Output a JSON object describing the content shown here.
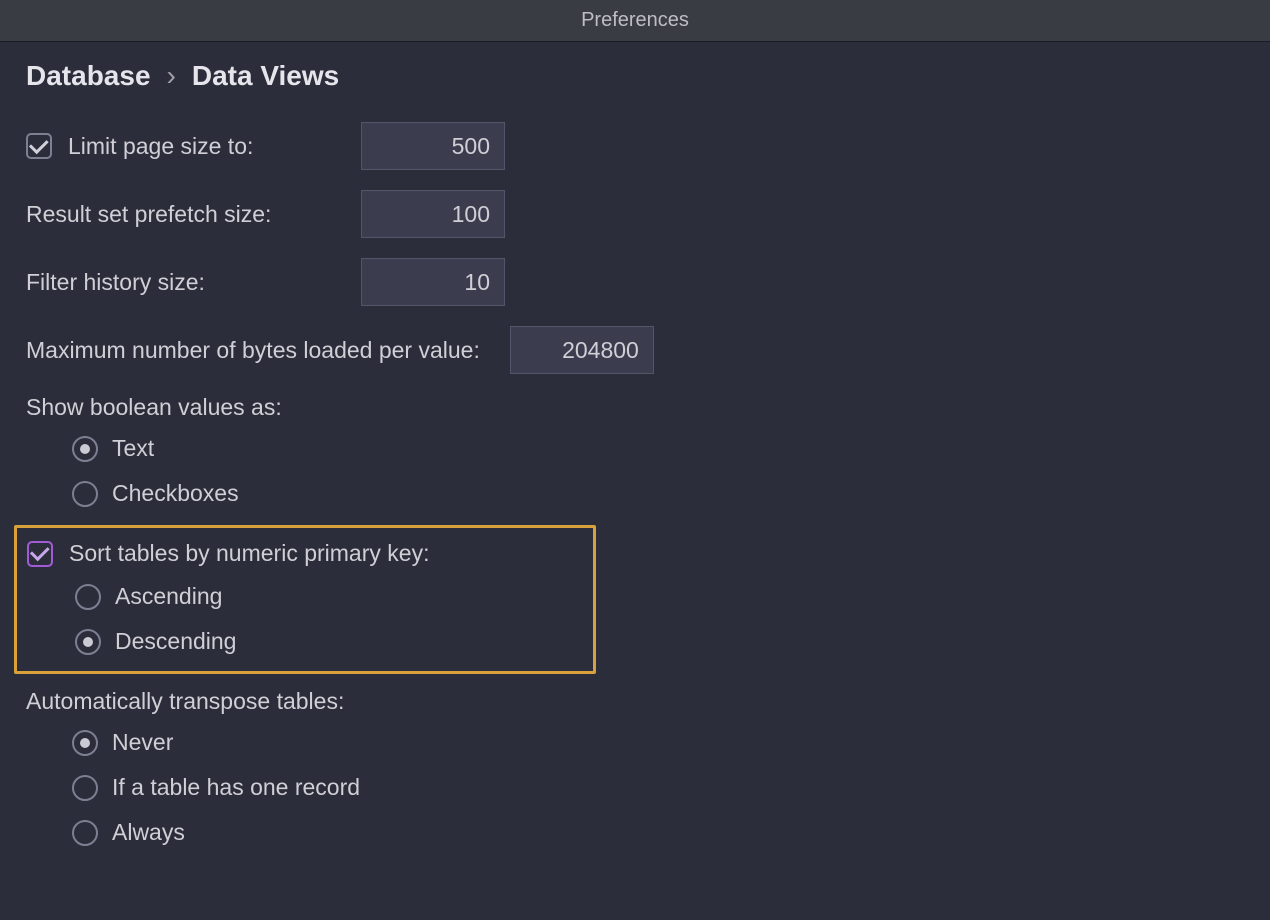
{
  "window": {
    "title": "Preferences"
  },
  "breadcrumb": {
    "parent": "Database",
    "sep": "›",
    "current": "Data Views"
  },
  "limitPage": {
    "checked": true,
    "label": "Limit page size to:",
    "value": "500"
  },
  "prefetch": {
    "label": "Result set prefetch size:",
    "value": "100"
  },
  "filterHistory": {
    "label": "Filter history size:",
    "value": "10"
  },
  "maxBytes": {
    "label": "Maximum number of bytes loaded per value:",
    "value": "204800"
  },
  "boolDisplay": {
    "label": "Show boolean values as:",
    "options": {
      "text": "Text",
      "checkboxes": "Checkboxes"
    },
    "selected": "text"
  },
  "sortPK": {
    "checked": true,
    "label": "Sort tables by numeric primary key:",
    "options": {
      "asc": "Ascending",
      "desc": "Descending"
    },
    "selected": "desc"
  },
  "transpose": {
    "label": "Automatically transpose tables:",
    "options": {
      "never": "Never",
      "one": "If a table has one record",
      "always": "Always"
    },
    "selected": "never"
  }
}
